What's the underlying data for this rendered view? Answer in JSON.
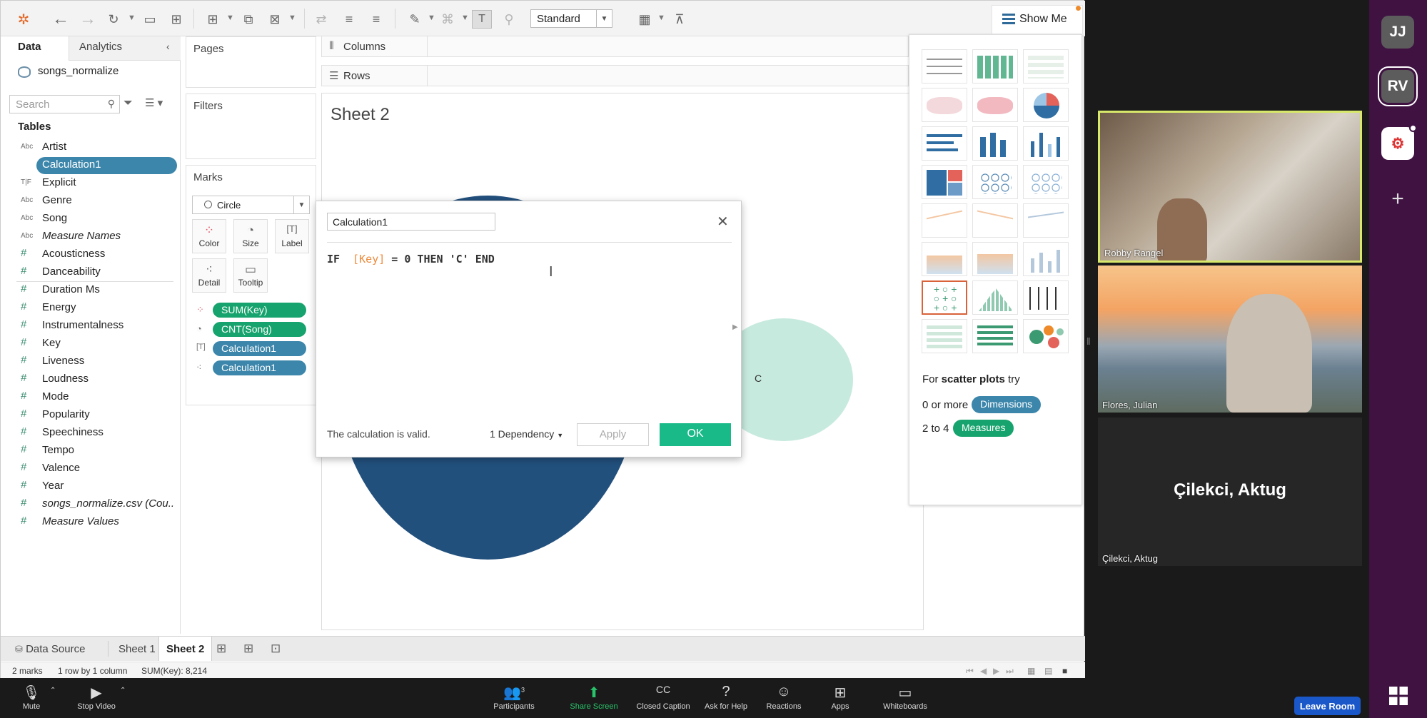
{
  "toolbar": {
    "mark_standard": "Standard",
    "show_me": "Show Me"
  },
  "data_pane": {
    "tab_data": "Data",
    "tab_analytics": "Analytics",
    "datasource": "songs_normalize",
    "search_placeholder": "Search",
    "tables_heading": "Tables",
    "dimensions": [
      {
        "type": "Abc",
        "name": "Artist"
      },
      {
        "type": "=Abc",
        "name": "Calculation1"
      },
      {
        "type": "T|F",
        "name": "Explicit"
      },
      {
        "type": "Abc",
        "name": "Genre"
      },
      {
        "type": "Abc",
        "name": "Song"
      },
      {
        "type": "Abc",
        "name": "Measure Names"
      }
    ],
    "measures": [
      {
        "type": "#",
        "name": "Acousticness"
      },
      {
        "type": "#",
        "name": "Danceability"
      },
      {
        "type": "#",
        "name": "Duration Ms"
      },
      {
        "type": "#",
        "name": "Energy"
      },
      {
        "type": "#",
        "name": "Instrumentalness"
      },
      {
        "type": "#",
        "name": "Key"
      },
      {
        "type": "#",
        "name": "Liveness"
      },
      {
        "type": "#",
        "name": "Loudness"
      },
      {
        "type": "#",
        "name": "Mode"
      },
      {
        "type": "#",
        "name": "Popularity"
      },
      {
        "type": "#",
        "name": "Speechiness"
      },
      {
        "type": "#",
        "name": "Tempo"
      },
      {
        "type": "#",
        "name": "Valence"
      },
      {
        "type": "#",
        "name": "Year"
      },
      {
        "type": "#",
        "name": "songs_normalize.csv (Cou..."
      },
      {
        "type": "#",
        "name": "Measure Values"
      }
    ]
  },
  "shelves": {
    "pages": "Pages",
    "filters": "Filters",
    "marks": "Marks",
    "columns": "Columns",
    "rows": "Rows"
  },
  "marks": {
    "type": "Circle",
    "buttons": [
      "Color",
      "Size",
      "Label",
      "Detail",
      "Tooltip"
    ],
    "pills": [
      "SUM(Key)",
      "CNT(Song)",
      "Calculation1",
      "Calculation1"
    ]
  },
  "canvas": {
    "sheet_title": "Sheet 2",
    "circle_label": "C"
  },
  "calc_dialog": {
    "name": "Calculation1",
    "formula_if": "IF ",
    "formula_key": "[Key]",
    "formula_rest": " = 0 THEN 'C' END",
    "status": "The calculation is valid.",
    "dependency": "1 Dependency",
    "apply": "Apply",
    "ok": "OK"
  },
  "show_me": {
    "for_text": "For ",
    "for_bold": "scatter plots",
    "for_try": " try",
    "dims_prefix": "0 or more",
    "dims_pill": "Dimensions",
    "meas_prefix": "2 to 4",
    "meas_pill": "Measures"
  },
  "tabs": {
    "data_source": "Data Source",
    "sheet1": "Sheet 1",
    "sheet2": "Sheet 2"
  },
  "status": {
    "marks": "2 marks",
    "rows_cols": "1 row by 1 column",
    "sum": "SUM(Key): 8,214"
  },
  "zoom": {
    "participants": [
      "Robby Rangel",
      "Flores, Julian",
      "Çilekci, Aktug"
    ],
    "participants_big": "Çilekci, Aktug",
    "participant_count": "3",
    "bar": [
      "Mute",
      "Stop Video",
      "Participants",
      "Share Screen",
      "Closed Caption",
      "Ask for Help",
      "Reactions",
      "Apps",
      "Whiteboards"
    ],
    "leave": "Leave Room"
  },
  "slack": {
    "ws1": "JJ",
    "ws2": "RV",
    "add": "+"
  },
  "colors": {
    "accent_green": "#1ab988",
    "pill_blue": "#3c86ab",
    "pill_green": "#17a36d",
    "circle_dark": "#22507d",
    "circle_light": "#c7eadf",
    "slack_bg": "#3f1242"
  }
}
